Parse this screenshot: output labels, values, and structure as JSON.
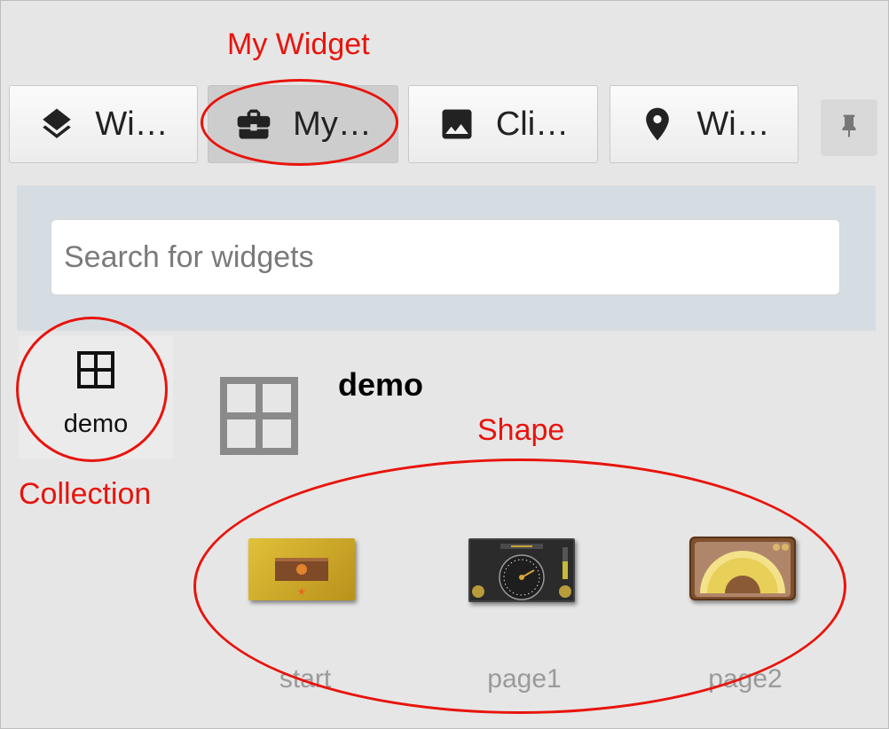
{
  "tabs": [
    {
      "label": "Wi…",
      "icon": "layers-icon"
    },
    {
      "label": "My…",
      "icon": "briefcase-icon",
      "active": true
    },
    {
      "label": "Cli…",
      "icon": "image-icon"
    },
    {
      "label": "Wi…",
      "icon": "map-marker-icon"
    }
  ],
  "pin_icon": "pin-icon",
  "search": {
    "placeholder": "Search for widgets",
    "value": ""
  },
  "collection": {
    "label": "demo",
    "icon": "grid-icon"
  },
  "collection_title": "demo",
  "shapes": [
    {
      "label": "start"
    },
    {
      "label": "page1"
    },
    {
      "label": "page2"
    }
  ],
  "annotations": {
    "my_widget": "My Widget",
    "collection": "Collection",
    "shape": "Shape"
  },
  "colors": {
    "annotation": "#e8140c",
    "search_panel": "#d5dde2",
    "active_tab": "#cdcdcd"
  }
}
